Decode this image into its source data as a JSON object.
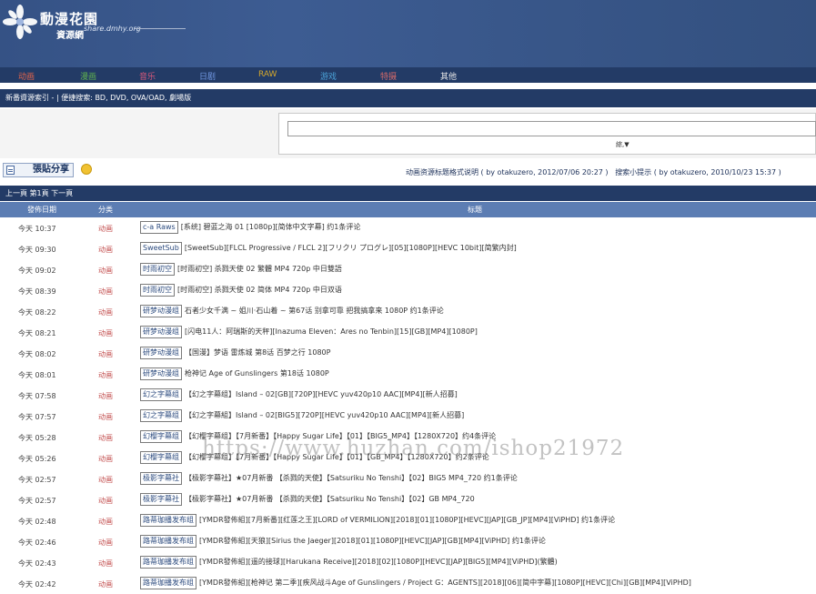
{
  "colors": {
    "header_bg": "#355285",
    "bar_bg": "#233b66",
    "col_header_bg": "#5c7db3",
    "category_red": "#c34f4f"
  },
  "site": {
    "title": "動漫花園",
    "subtitle": "資源網",
    "domain": "share.dmhy.org"
  },
  "menu": [
    {
      "label": "动画",
      "color": "#e0634a"
    },
    {
      "label": "漫画",
      "color": "#5fb14d"
    },
    {
      "label": "音乐",
      "color": "#d6587a"
    },
    {
      "label": "日剧",
      "color": "#6f96e0"
    },
    {
      "label": "RAW",
      "color": "#d4a72c"
    },
    {
      "label": "游戏",
      "color": "#4aa0d6"
    },
    {
      "label": "特摄",
      "color": "#d46a6a"
    },
    {
      "label": "其他",
      "color": "#e8e8e8"
    }
  ],
  "crumb": "新番資源索引 - | 便捷搜索: BD, DVD, OVA/OAD, 劇場版",
  "search": {
    "advanced_label": "綜,▼"
  },
  "post_button_label": "張貼分享",
  "help": {
    "format_link": "动画资源标题格式说明 ( by otakuzero, 2012/07/06 20:27 )",
    "search_tip_link": "搜索小提示 ( by otakuzero, 2010/10/23 15:37 )"
  },
  "pager": "上一頁 第1頁 下一頁",
  "columns": {
    "date": "發佈日期",
    "category": "分类",
    "title": "标题"
  },
  "rows": [
    {
      "date": "今天 10:37",
      "cat": "动画",
      "tag": "c-a Raws",
      "title": "[系统] 碧蓝之海 01 [1080p][简体中文字幕] 约1条评论"
    },
    {
      "date": "今天 09:30",
      "cat": "动画",
      "tag": "SweetSub",
      "title": "[SweetSub][FLCL Progressive / FLCL 2][フリクリ プログレ][05][1080P][HEVC 10bit][简繁内封]"
    },
    {
      "date": "今天 09:02",
      "cat": "动画",
      "tag": "时雨初空",
      "title": "[时雨初空] 杀戮天使 02 繁體 MP4 720p 中日雙語"
    },
    {
      "date": "今天 08:39",
      "cat": "动画",
      "tag": "时雨初空",
      "title": "[时雨初空] 杀戮天使 02 简体 MP4 720p 中日双语"
    },
    {
      "date": "今天 08:22",
      "cat": "动画",
      "tag": "研梦动漫组",
      "title": "石者少女千满 ~ 姐川·石山着 ~ 第67话 别拿可靠 把我搞拿来 1080P 约1条评论"
    },
    {
      "date": "今天 08:21",
      "cat": "动画",
      "tag": "研梦动漫组",
      "title": "[闪电11人：阿瑞斯的天秤][Inazuma Eleven：Ares no Tenbin][15][GB][MP4][1080P]"
    },
    {
      "date": "今天 08:02",
      "cat": "动画",
      "tag": "研梦动漫组",
      "title": "【国漫】梦语 雷炼城 第8话 百梦之行 1080P"
    },
    {
      "date": "今天 08:01",
      "cat": "动画",
      "tag": "研梦动漫组",
      "title": "枪神记 Age of Gunslingers 第18话 1080P"
    },
    {
      "date": "今天 07:58",
      "cat": "动画",
      "tag": "幻之字幕组",
      "title": "【幻之字幕组】Island – 02[GB][720P][HEVC yuv420p10 AAC][MP4][新人招募]"
    },
    {
      "date": "今天 07:57",
      "cat": "动画",
      "tag": "幻之字幕组",
      "title": "【幻之字幕組】Island – 02[BIG5][720P][HEVC yuv420p10 AAC][MP4][新人招募]"
    },
    {
      "date": "今天 05:28",
      "cat": "动画",
      "tag": "幻樱字幕组",
      "title": "【幻樱字幕组】【7月新番】【Happy Sugar Life】【01】【BIG5_MP4】【1280X720】约4条评论"
    },
    {
      "date": "今天 05:26",
      "cat": "动画",
      "tag": "幻樱字幕组",
      "title": "【幻樱字幕组】【7月新番】【Happy Sugar Life】【01】【GB_MP4】【1280X720】约2条评论"
    },
    {
      "date": "今天 02:57",
      "cat": "动画",
      "tag": "极影字幕社",
      "title": "【极影字幕社】★07月新番 【杀戮的天使】【Satsuriku No Tenshi】【02】BIG5 MP4_720 约1条评论"
    },
    {
      "date": "今天 02:57",
      "cat": "动画",
      "tag": "极影字幕社",
      "title": "【极影字幕社】★07月新番 【杀戮的天使】【Satsuriku No Tenshi】【02】GB MP4_720"
    },
    {
      "date": "今天 02:48",
      "cat": "动画",
      "tag": "路蒂珈播发布组",
      "title": "[YMDR發佈組][7月新番][红莲之王][LORD of VERMILION][2018][01][1080P][HEVC][JAP][GB_JP][MP4][ViPHD] 约1条评论"
    },
    {
      "date": "今天 02:46",
      "cat": "动画",
      "tag": "路蒂珈播发布组",
      "title": "[YMDR發佈組][天狼][Sirius the Jaeger][2018][01][1080P][HEVC][JAP][GB][MP4][ViPHD] 约1条评论"
    },
    {
      "date": "今天 02:43",
      "cat": "动画",
      "tag": "路蒂珈播发布组",
      "title": "[YMDR發佈組][遥的接球][Harukana Receive][2018][02][1080P][HEVC][JAP][BIG5][MP4][ViPHD](繁體)"
    },
    {
      "date": "今天 02:42",
      "cat": "动画",
      "tag": "路蒂珈播发布组",
      "title": "[YMDR發佈組][枪神记 第二季][疾风战斗Age of Gunslingers / Project G：AGENTS][2018][06][简中字幕][1080P][HEVC][Chi][GB][MP4][ViPHD]"
    }
  ],
  "watermark": "https://www.huzhan.com/ishop21972"
}
